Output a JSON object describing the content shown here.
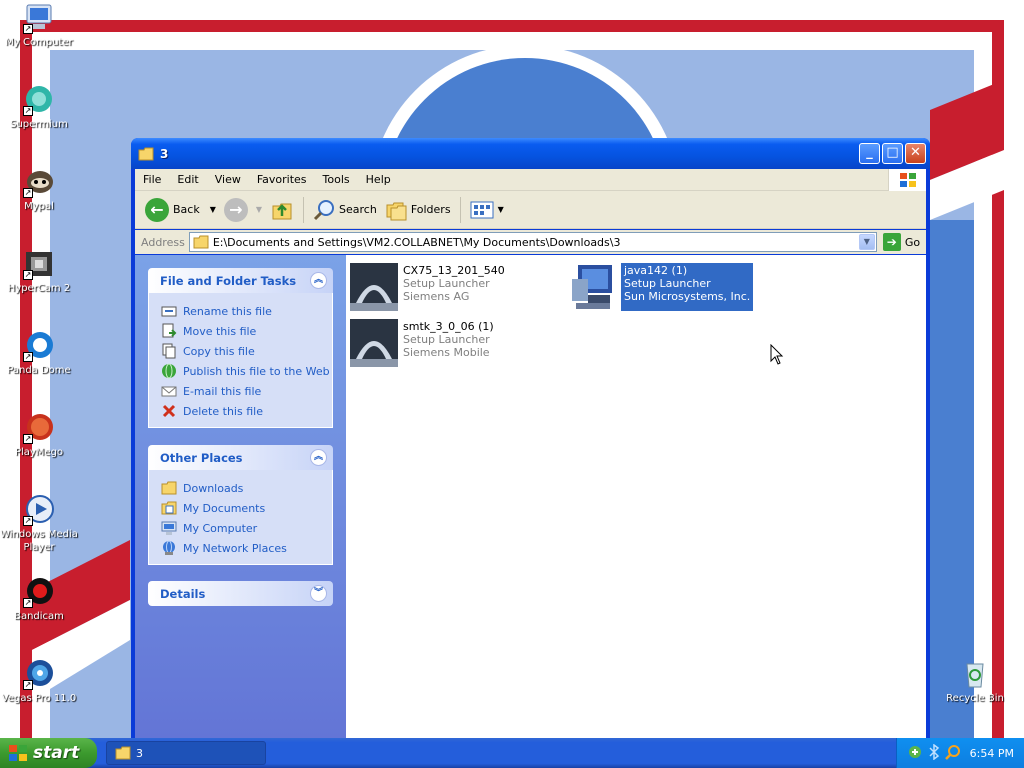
{
  "desktop": {
    "icons": [
      {
        "label": "My Computer"
      },
      {
        "label": "Supermium"
      },
      {
        "label": "Mypal"
      },
      {
        "label": "HyperCam 2"
      },
      {
        "label": "Panda Dome"
      },
      {
        "label": "PlayMego"
      },
      {
        "label": "Windows Media Player"
      },
      {
        "label": "Bandicam"
      },
      {
        "label": "Vegas Pro 11.0"
      }
    ],
    "recycle_bin": {
      "label": "Recycle Bin"
    }
  },
  "window": {
    "title": "3",
    "menu": [
      "File",
      "Edit",
      "View",
      "Favorites",
      "Tools",
      "Help"
    ],
    "toolbar": {
      "back": "Back",
      "search": "Search",
      "folders": "Folders"
    },
    "address": {
      "label": "Address",
      "value": "E:\\Documents and Settings\\VM2.COLLABNET\\My Documents\\Downloads\\3",
      "go": "Go"
    },
    "tasks": {
      "title": "File and Folder Tasks",
      "items": [
        "Rename this file",
        "Move this file",
        "Copy this file",
        "Publish this file to the Web",
        "E-mail this file",
        "Delete this file"
      ]
    },
    "places": {
      "title": "Other Places",
      "items": [
        "Downloads",
        "My Documents",
        "My Computer",
        "My Network Places"
      ]
    },
    "details": {
      "title": "Details"
    },
    "files": [
      {
        "name": "CX75_13_201_540",
        "type": "Setup Launcher",
        "company": "Siemens AG",
        "selected": false
      },
      {
        "name": "java142 (1)",
        "type": "Setup Launcher",
        "company": "Sun Microsystems, Inc.",
        "selected": true
      },
      {
        "name": "smtk_3_0_06 (1)",
        "type": "Setup Launcher",
        "company": "Siemens Mobile",
        "selected": false
      }
    ]
  },
  "taskbar": {
    "start": "start",
    "item": "3",
    "clock": "6:54 PM"
  },
  "colors": {
    "selection": "#316ac5",
    "link": "#215dc6",
    "taskbar": "#245edb",
    "wallpaper_red": "#c81e2e",
    "wallpaper_blue": "#5a8fd8"
  }
}
